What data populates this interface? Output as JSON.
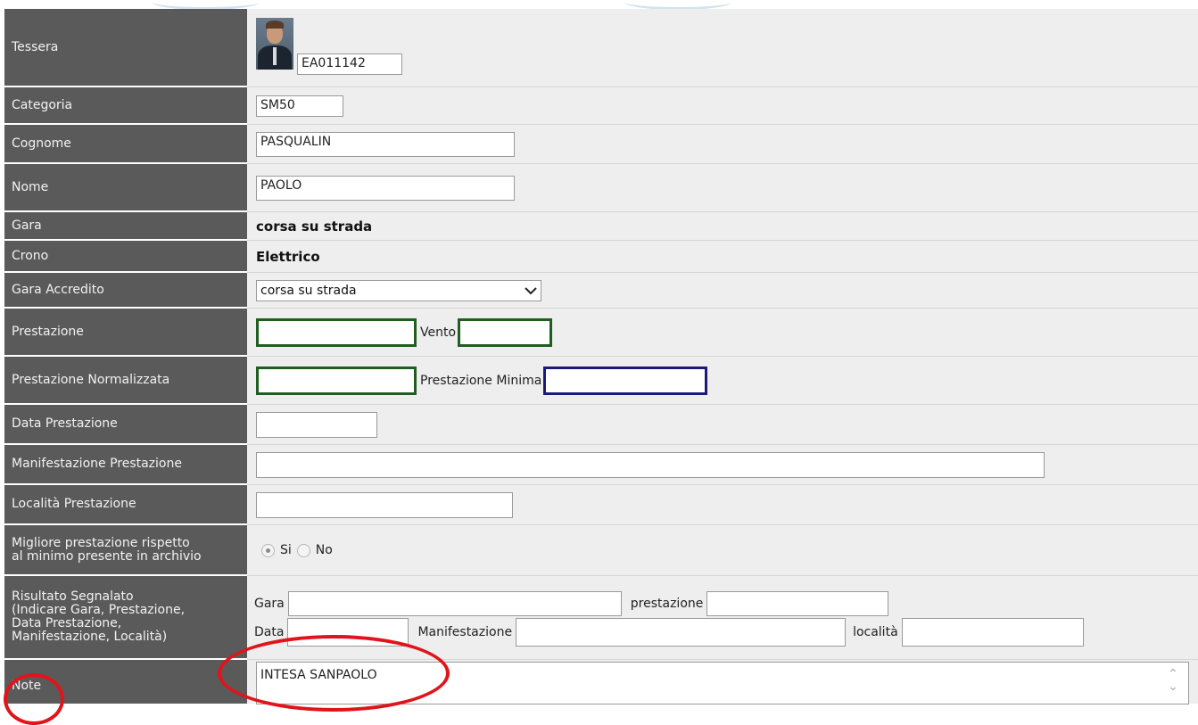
{
  "fields": {
    "tessera": {
      "label": "Tessera",
      "value": "EA011142"
    },
    "categoria": {
      "label": "Categoria",
      "value": "SM50"
    },
    "cognome": {
      "label": "Cognome",
      "value": "PASQUALIN"
    },
    "nome": {
      "label": "Nome",
      "value": "PAOLO"
    },
    "gara": {
      "label": "Gara",
      "value": "corsa su strada"
    },
    "crono": {
      "label": "Crono",
      "value": "Elettrico"
    },
    "gara_accredito": {
      "label": "Gara Accredito",
      "value": "corsa su strada"
    },
    "prestazione": {
      "label": "Prestazione",
      "value": "",
      "vento_label": "Vento",
      "vento_value": ""
    },
    "prestazione_normalizzata": {
      "label": "Prestazione Normalizzata",
      "value": "",
      "minima_label": "Prestazione Minima",
      "minima_value": ""
    },
    "data_prestazione": {
      "label": "Data Prestazione",
      "value": ""
    },
    "manifestazione_prestazione": {
      "label": "Manifestazione Prestazione",
      "value": ""
    },
    "localita_prestazione": {
      "label": "Località Prestazione",
      "value": ""
    },
    "migliore": {
      "label_line1": "Migliore prestazione rispetto",
      "label_line2": "al minimo presente in archivio",
      "option_si": "Si",
      "option_no": "No",
      "selected": "Si"
    },
    "risultato": {
      "label_line1": "Risultato Segnalato",
      "label_line2": "(Indicare Gara, Prestazione,",
      "label_line3": "Data Prestazione,",
      "label_line4": "Manifestazione, Località)",
      "gara_label": "Gara",
      "prestazione_label": "prestazione",
      "data_label": "Data",
      "manifestazione_label": "Manifestazione",
      "localita_label": "località"
    },
    "note": {
      "label": "Note",
      "value": "INTESA SANPAOLO"
    }
  },
  "colors": {
    "label_bg": "#5a5a5a",
    "value_bg": "#eeeeee",
    "annotation_red": "#e0141a",
    "green_border": "#1f5e1f",
    "blue_border": "#1a1a7a"
  },
  "icons": {
    "dropdown": "chevron-down-icon",
    "scroll_up": "scroll-up-icon",
    "scroll_down": "scroll-down-icon"
  }
}
